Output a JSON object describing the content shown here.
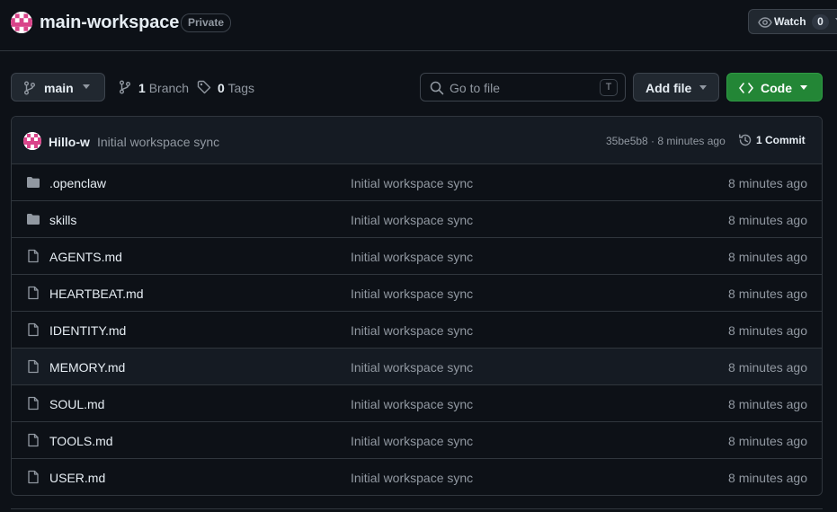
{
  "repo": {
    "name": "main-workspace",
    "visibility": "Private",
    "watch_label": "Watch",
    "watch_count": "0"
  },
  "toolbar": {
    "branch": "main",
    "branches_count": "1",
    "branches_label": "Branch",
    "tags_count": "0",
    "tags_label": "Tags",
    "search_placeholder": "Go to file",
    "search_shortcut": "T",
    "add_file_label": "Add file",
    "code_label": "Code"
  },
  "latest_commit": {
    "author": "Hillo-w",
    "message": "Initial workspace sync",
    "sha_time": "35be5b8 · 8 minutes ago",
    "commits_label": "1 Commit"
  },
  "files": [
    {
      "name": ".openclaw",
      "type": "folder",
      "message": "Initial workspace sync",
      "date": "8 minutes ago"
    },
    {
      "name": "skills",
      "type": "folder",
      "message": "Initial workspace sync",
      "date": "8 minutes ago"
    },
    {
      "name": "AGENTS.md",
      "type": "file",
      "message": "Initial workspace sync",
      "date": "8 minutes ago"
    },
    {
      "name": "HEARTBEAT.md",
      "type": "file",
      "message": "Initial workspace sync",
      "date": "8 minutes ago"
    },
    {
      "name": "IDENTITY.md",
      "type": "file",
      "message": "Initial workspace sync",
      "date": "8 minutes ago"
    },
    {
      "name": "MEMORY.md",
      "type": "file",
      "message": "Initial workspace sync",
      "date": "8 minutes ago"
    },
    {
      "name": "SOUL.md",
      "type": "file",
      "message": "Initial workspace sync",
      "date": "8 minutes ago"
    },
    {
      "name": "TOOLS.md",
      "type": "file",
      "message": "Initial workspace sync",
      "date": "8 minutes ago"
    },
    {
      "name": "USER.md",
      "type": "file",
      "message": "Initial workspace sync",
      "date": "8 minutes ago"
    }
  ],
  "colors": {
    "background": "#0d1117",
    "border": "#30363d",
    "muted_text": "#9198a1",
    "primary_button": "#238636",
    "avatar_pink": "#d9448a"
  },
  "icons": {
    "avatar": "identicon-avatar",
    "watch": "eye-icon",
    "branch": "git-branch-icon",
    "tag": "tag-icon",
    "search": "search-icon",
    "code": "code-icon",
    "history": "history-icon",
    "folder": "folder-icon",
    "file": "file-icon"
  }
}
